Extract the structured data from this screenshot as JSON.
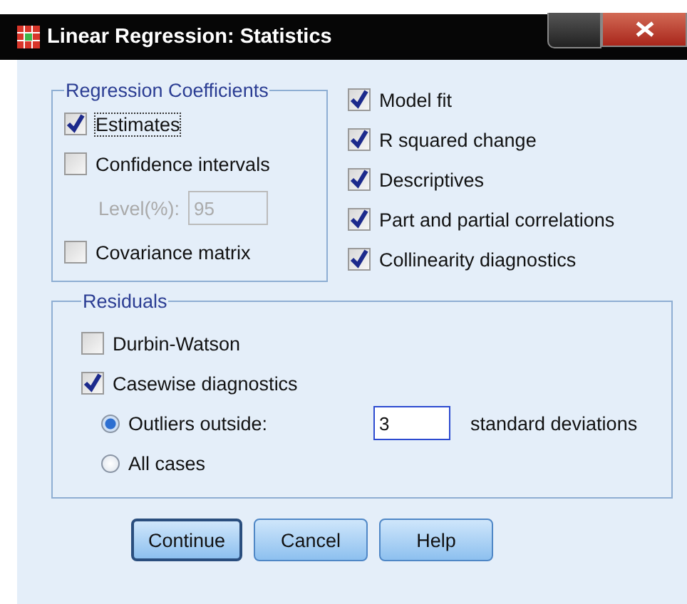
{
  "window": {
    "title": "Linear Regression: Statistics"
  },
  "regression_coefficients": {
    "title": "Regression Coefficients",
    "items": [
      {
        "kind": "checkbox",
        "label": "Estimates",
        "checked": true,
        "focused": true
      },
      {
        "kind": "checkbox",
        "label": "Confidence intervals",
        "checked": false,
        "focused": false
      },
      {
        "kind": "field",
        "label": "Level(%):",
        "value": "95",
        "disabled": true
      },
      {
        "kind": "checkbox",
        "label": "Covariance matrix",
        "checked": false,
        "focused": false
      }
    ]
  },
  "statistics": [
    {
      "label": "Model fit",
      "checked": true
    },
    {
      "label": "R squared change",
      "checked": true
    },
    {
      "label": "Descriptives",
      "checked": true
    },
    {
      "label": "Part and partial correlations",
      "checked": true
    },
    {
      "label": "Collinearity diagnostics",
      "checked": true
    }
  ],
  "residuals": {
    "title": "Residuals",
    "checks": [
      {
        "label": "Durbin-Watson",
        "checked": false
      },
      {
        "label": "Casewise diagnostics",
        "checked": true
      }
    ],
    "radios": [
      {
        "label": "Outliers outside:",
        "selected": true,
        "value": "3",
        "suffix": "standard deviations"
      },
      {
        "label": "All cases",
        "selected": false
      }
    ]
  },
  "buttons": [
    {
      "label": "Continue",
      "default": true
    },
    {
      "label": "Cancel",
      "default": false
    },
    {
      "label": "Help",
      "default": false
    }
  ]
}
